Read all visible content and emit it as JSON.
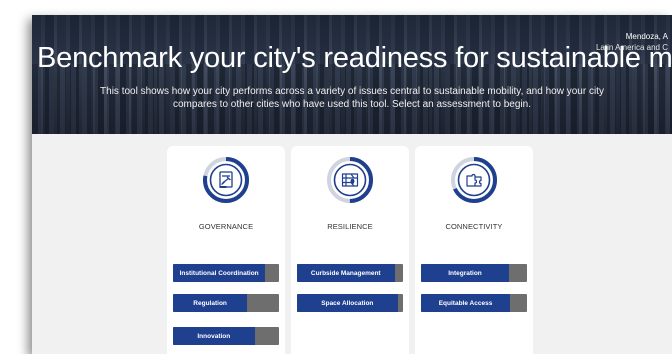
{
  "hero": {
    "title": "Benchmark your city's readiness for sustainable mobility",
    "subtitle": "This tool shows how your city performs across a variety of issues central to sustainable mobility, and how your city compares to other cities who have used this tool. Select an assessment to begin.",
    "location_city": "Mendoza, A",
    "location_region": "Latin America and C"
  },
  "colors": {
    "accent": "#1f3f8f",
    "ring_track": "#cfd4de",
    "pill_remaining": "#6e6e6e",
    "panel_bg": "#f1f1f1"
  },
  "cards": [
    {
      "title": "GOVERNANCE",
      "icon": "gavel-document-icon",
      "progress": 0.78,
      "items": [
        {
          "label": "Institutional Coordination",
          "progress": 0.87
        },
        {
          "label": "Regulation",
          "progress": 0.7
        },
        {
          "label": "Innovation",
          "progress": 0.77
        }
      ]
    },
    {
      "title": "RESILIENCE",
      "icon": "map-roads-icon",
      "progress": 0.5,
      "items": [
        {
          "label": "Curbside Management",
          "progress": 0.92
        },
        {
          "label": "Space Allocation",
          "progress": 0.95
        }
      ]
    },
    {
      "title": "CONNECTIVITY",
      "icon": "puzzle-pieces-icon",
      "progress": 0.68,
      "items": [
        {
          "label": "Integration",
          "progress": 0.83
        },
        {
          "label": "Equitable Access",
          "progress": 0.84
        }
      ]
    }
  ]
}
